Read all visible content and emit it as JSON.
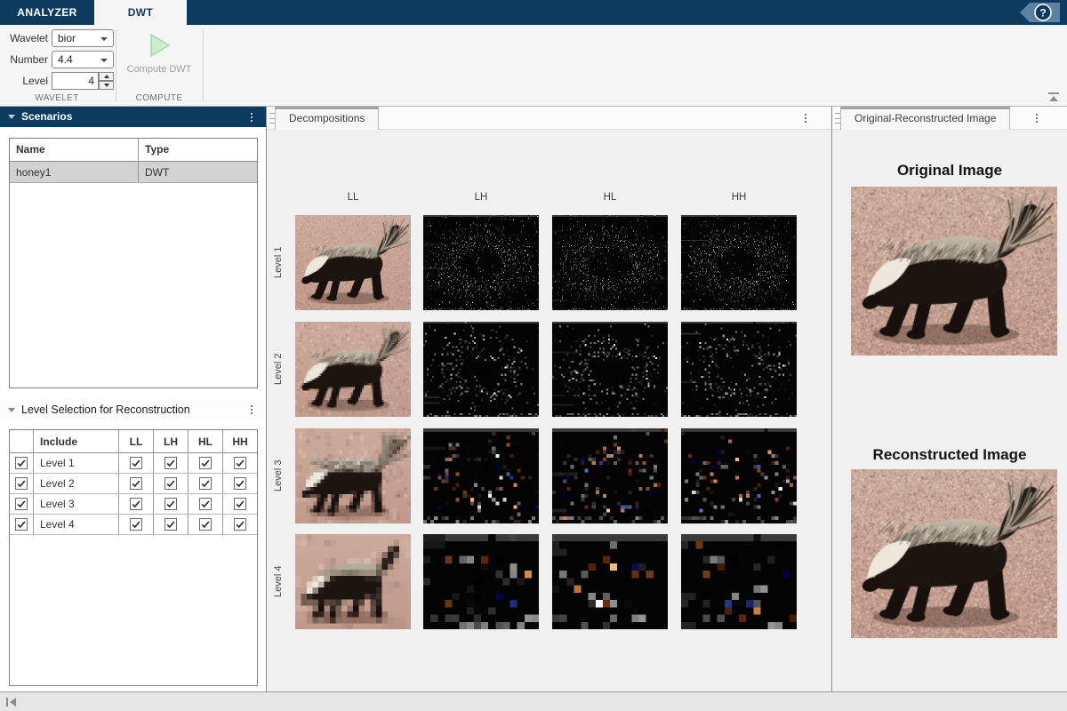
{
  "tabstrip": {
    "analyzer_tab": "ANALYZER",
    "dwt_tab": "DWT",
    "help_label": "?"
  },
  "ribbon": {
    "wavelet_label": "Wavelet",
    "wavelet_value": "bior",
    "number_label": "Number",
    "number_value": "4.4",
    "level_label": "Level",
    "level_value": "4",
    "compute_label": "Compute DWT",
    "wavelet_section": "WAVELET",
    "compute_section": "COMPUTE"
  },
  "scenarios": {
    "title": "Scenarios",
    "name_col": "Name",
    "type_col": "Type",
    "rows": [
      {
        "name": "honey1",
        "type": "DWT"
      }
    ]
  },
  "level_selection": {
    "title": "Level Selection for Reconstruction",
    "include_col": "Include",
    "ll_col": "LL",
    "lh_col": "LH",
    "hl_col": "HL",
    "hh_col": "HH",
    "rows": [
      {
        "label": "Level 1",
        "include": true,
        "ll": true,
        "lh": true,
        "hl": true,
        "hh": true
      },
      {
        "label": "Level 2",
        "include": true,
        "ll": true,
        "lh": true,
        "hl": true,
        "hh": true
      },
      {
        "label": "Level 3",
        "include": true,
        "ll": true,
        "lh": true,
        "hl": true,
        "hh": true
      },
      {
        "label": "Level 4",
        "include": true,
        "ll": true,
        "lh": true,
        "hl": true,
        "hh": true
      }
    ]
  },
  "decompositions": {
    "tab": "Decompositions",
    "columns": [
      "LL",
      "LH",
      "HL",
      "HH"
    ],
    "row_labels": [
      "Level 1",
      "Level 2",
      "Level 3",
      "Level 4"
    ]
  },
  "comparison": {
    "tab": "Original-Reconstructed Image",
    "original_title": "Original Image",
    "reconstructed_title": "Reconstructed Image"
  },
  "colors": {
    "accent_navy": "#0d3a5f",
    "play_green": "#cdeccd",
    "selected_row": "#d2d2d2"
  }
}
